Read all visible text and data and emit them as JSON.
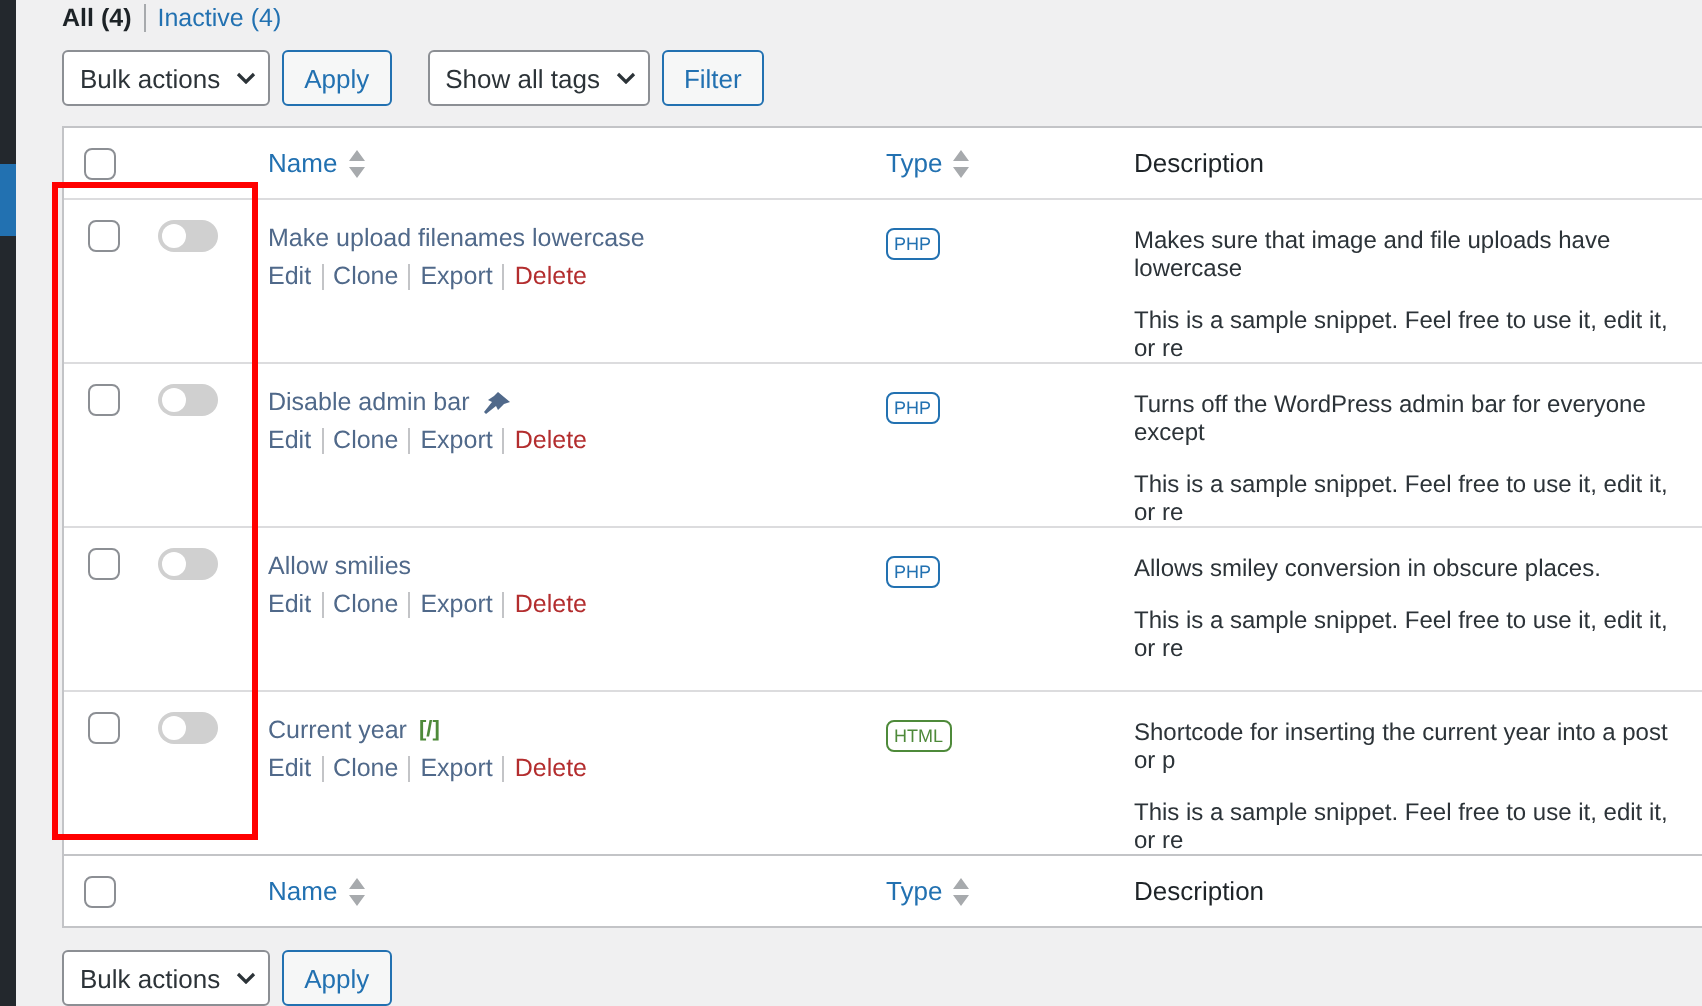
{
  "views": [
    {
      "label": "All",
      "count": "(4)",
      "selected": true
    },
    {
      "label": "Inactive",
      "count": "(4)",
      "selected": false
    }
  ],
  "top_actions": {
    "bulk_select": "Bulk actions",
    "apply": "Apply",
    "tags_select": "Show all tags",
    "filter": "Filter"
  },
  "header_checked": false,
  "columns": [
    {
      "label": "Name",
      "sortable": true
    },
    {
      "label": "Type",
      "sortable": true
    },
    {
      "label": "Description",
      "sortable": false
    }
  ],
  "snippets": [
    {
      "name": "Make upload filenames lowercase",
      "pinned": false,
      "active": false,
      "checked": false,
      "type": "PHP",
      "color": "#2271b1",
      "description": "Makes sure that image and file uploads have lowercase",
      "note": "This is a sample snippet. Feel free to use it, edit it, or re",
      "actions": [
        {
          "label": "Edit",
          "kind": "link"
        },
        {
          "label": "Clone",
          "kind": "link"
        },
        {
          "label": "Export",
          "kind": "link"
        },
        {
          "label": "Delete",
          "kind": "danger"
        }
      ]
    },
    {
      "name": "Disable admin bar",
      "pinned": true,
      "active": false,
      "checked": false,
      "type": "PHP",
      "color": "#2271b1",
      "description": "Turns off the WordPress admin bar for everyone except",
      "note": "This is a sample snippet. Feel free to use it, edit it, or re",
      "actions": [
        {
          "label": "Edit",
          "kind": "link"
        },
        {
          "label": "Clone",
          "kind": "link"
        },
        {
          "label": "Export",
          "kind": "link"
        },
        {
          "label": "Delete",
          "kind": "danger"
        }
      ]
    },
    {
      "name": "Allow smilies",
      "pinned": false,
      "active": false,
      "checked": false,
      "type": "PHP",
      "color": "#2271b1",
      "description": "Allows smiley conversion in obscure places.",
      "note": "This is a sample snippet. Feel free to use it, edit it, or re",
      "actions": [
        {
          "label": "Edit",
          "kind": "link"
        },
        {
          "label": "Clone",
          "kind": "link"
        },
        {
          "label": "Export",
          "kind": "link"
        },
        {
          "label": "Delete",
          "kind": "danger"
        }
      ]
    },
    {
      "name": "Current year",
      "shortcode_tag": "[/]",
      "pinned": false,
      "active": false,
      "checked": false,
      "type": "HTML",
      "color": "#4e8a3a",
      "description": "Shortcode for inserting the current year into a post or p",
      "note": "This is a sample snippet. Feel free to use it, edit it, or re",
      "actions": [
        {
          "label": "Edit",
          "kind": "link"
        },
        {
          "label": "Clone",
          "kind": "link"
        },
        {
          "label": "Export",
          "kind": "link"
        },
        {
          "label": "Delete",
          "kind": "danger"
        }
      ]
    }
  ],
  "footer_checked": false,
  "footer_columns": [
    {
      "label": "Name",
      "sortable": true
    },
    {
      "label": "Type",
      "sortable": true
    },
    {
      "label": "Description",
      "sortable": false
    }
  ],
  "bottom_actions": {
    "bulk_select": "Bulk actions",
    "apply": "Apply"
  }
}
